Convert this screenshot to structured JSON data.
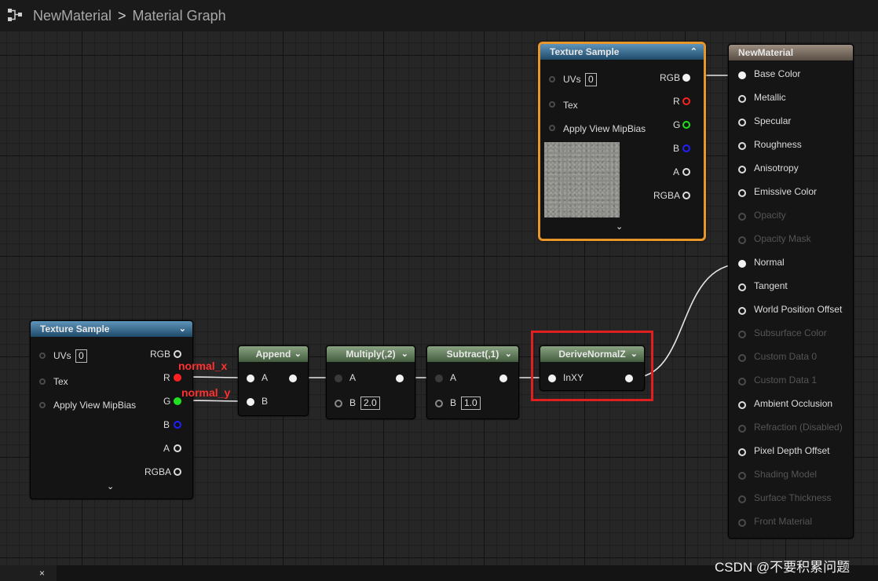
{
  "breadcrumb": {
    "material": "NewMaterial",
    "separator": ">",
    "graph": "Material Graph"
  },
  "texture_sample_top": {
    "title": "Texture Sample",
    "inputs": {
      "uvs": "UVs",
      "uvs_value": "0",
      "tex": "Tex",
      "mip": "Apply View MipBias"
    },
    "outputs": {
      "rgb": "RGB",
      "r": "R",
      "g": "G",
      "b": "B",
      "a": "A",
      "rgba": "RGBA"
    }
  },
  "texture_sample_left": {
    "title": "Texture Sample",
    "inputs": {
      "uvs": "UVs",
      "uvs_value": "0",
      "tex": "Tex",
      "mip": "Apply View MipBias"
    },
    "outputs": {
      "rgb": "RGB",
      "r": "R",
      "g": "G",
      "b": "B",
      "a": "A",
      "rgba": "RGBA"
    }
  },
  "annotations": {
    "normal_x": "normal_x",
    "normal_y": "normal_y"
  },
  "append_node": {
    "title": "Append",
    "a": "A",
    "b": "B"
  },
  "multiply_node": {
    "title": "Multiply(,2)",
    "a": "A",
    "b": "B",
    "b_value": "2.0"
  },
  "subtract_node": {
    "title": "Subtract(,1)",
    "a": "A",
    "b": "B",
    "b_value": "1.0"
  },
  "derive_node": {
    "title": "DeriveNormalZ",
    "input": "InXY"
  },
  "material_node": {
    "title": "NewMaterial",
    "pins": [
      {
        "label": "Base Color",
        "enabled": true
      },
      {
        "label": "Metallic",
        "enabled": true
      },
      {
        "label": "Specular",
        "enabled": true
      },
      {
        "label": "Roughness",
        "enabled": true
      },
      {
        "label": "Anisotropy",
        "enabled": true
      },
      {
        "label": "Emissive Color",
        "enabled": true
      },
      {
        "label": "Opacity",
        "enabled": false
      },
      {
        "label": "Opacity Mask",
        "enabled": false
      },
      {
        "label": "Normal",
        "enabled": true
      },
      {
        "label": "Tangent",
        "enabled": true
      },
      {
        "label": "World Position Offset",
        "enabled": true
      },
      {
        "label": "Subsurface Color",
        "enabled": false
      },
      {
        "label": "Custom Data 0",
        "enabled": false
      },
      {
        "label": "Custom Data 1",
        "enabled": false
      },
      {
        "label": "Ambient Occlusion",
        "enabled": true
      },
      {
        "label": "Refraction (Disabled)",
        "enabled": false
      },
      {
        "label": "Pixel Depth Offset",
        "enabled": true
      },
      {
        "label": "Shading Model",
        "enabled": false
      },
      {
        "label": "Surface Thickness",
        "enabled": false
      },
      {
        "label": "Front Material",
        "enabled": false
      }
    ]
  },
  "tab": {
    "close": "×"
  },
  "watermark": "CSDN @不要积累问题",
  "colors": {
    "selected_border": "#e8962a",
    "highlight_box": "#e02020",
    "pin_r": "#ff2020",
    "pin_g": "#20e020",
    "pin_b": "#2020ff"
  }
}
